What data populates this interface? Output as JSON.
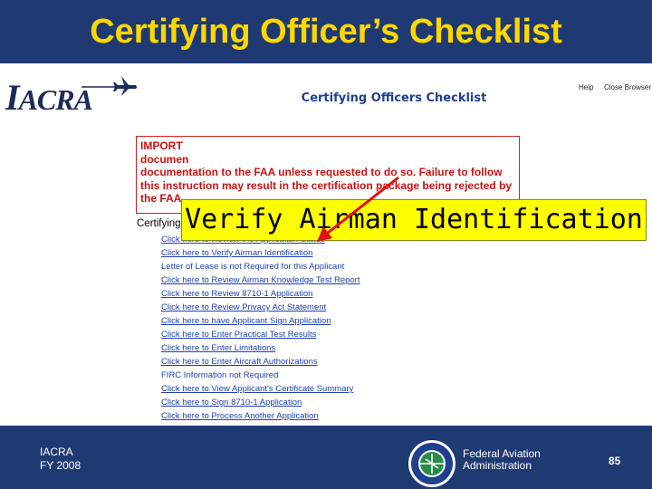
{
  "slide": {
    "title": "Certifying Officer’s Checklist"
  },
  "app": {
    "logo": {
      "first": "I",
      "rest": "ACRA"
    },
    "header_links": {
      "help": "Help",
      "close_browser": "Close Browser"
    },
    "page_heading": "Certifying Officers Checklist"
  },
  "important_notice": {
    "lines": [
      "IMPORT",
      "documen",
      "documentation to the FAA unless requested to do so. Failure to follow",
      "this instruction may result in the certification package being rejected by",
      "the FAA."
    ]
  },
  "checklist": {
    "heading": "Certifying Officer's Checklist",
    "items": [
      {
        "label": "Click here to Review the Application Status",
        "type": "link"
      },
      {
        "label": "Click here to Verify Airman Identification",
        "type": "link"
      },
      {
        "label": "Letter of Lease is not Required for this Applicant",
        "type": "plain"
      },
      {
        "label": "Click here to Review Airman Knowledge Test Report",
        "type": "link"
      },
      {
        "label": "Click here to Review 8710-1 Application",
        "type": "link"
      },
      {
        "label": "Click here to Review Privacy Act Statement",
        "type": "link"
      },
      {
        "label": "Click here to have Applicant Sign Application",
        "type": "link"
      },
      {
        "label": "Click here to Enter Practical Test Results",
        "type": "link"
      },
      {
        "label": "Click here to Enter Limitations",
        "type": "link"
      },
      {
        "label": "Click here to Enter Aircraft Authorizations",
        "type": "link"
      },
      {
        "label": "FIRC Information not Required",
        "type": "plain"
      },
      {
        "label": "Click here to View Applicant's Certificate Summary",
        "type": "link"
      },
      {
        "label": "Click here to Sign 8710-1 Application",
        "type": "link"
      },
      {
        "label": "Click here to Process Another Application",
        "type": "link"
      }
    ]
  },
  "callout": {
    "text": "Verify Airman Identification"
  },
  "footer": {
    "left_line1": "IACRA",
    "left_line2": "FY 2008",
    "agency_line1": "Federal Aviation",
    "agency_line2": "Administration",
    "page_number": "85"
  },
  "colors": {
    "slide_background": "#1f3a73",
    "title": "#ffd700",
    "callout_background": "#ffff00",
    "arrow": "#e01010",
    "link": "#1f3fb0",
    "notice": "#cc1111"
  }
}
